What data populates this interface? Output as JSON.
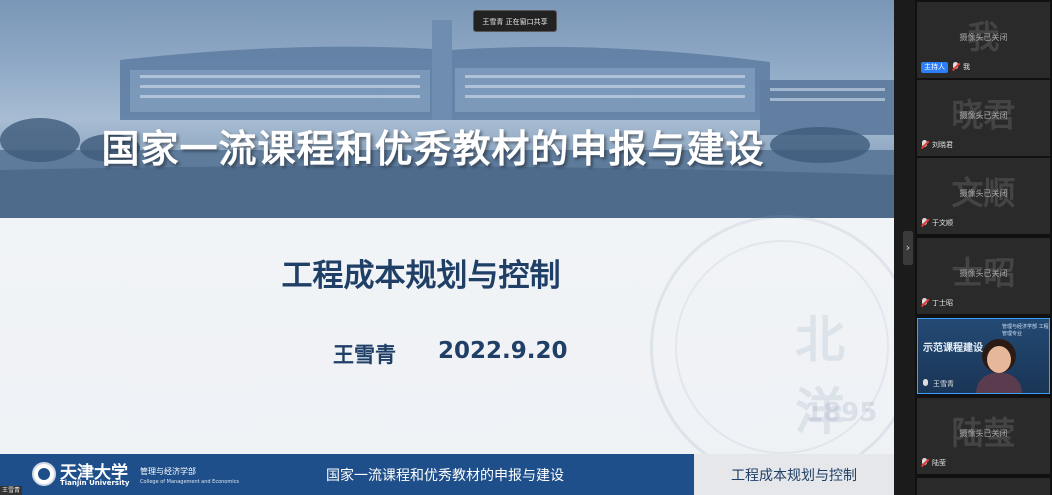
{
  "share_badge": "王雪青 正在窗口共享",
  "slide": {
    "banner_title": "国家一流课程和优秀教材的申报与建设",
    "course_title": "工程成本规划与控制",
    "author": "王雪青",
    "date": "2022.9.20",
    "seal_text": "北洋",
    "seal_year": "1895",
    "footer": {
      "university_cn": "天津大学",
      "university_en": "Tianjin University",
      "school_cn": "管理与经济学部",
      "school_en": "College of Management and Economics",
      "center_text": "国家一流课程和优秀教材的申报与建设",
      "right_text": "工程成本规划与控制"
    },
    "speaker_label": "王雪青"
  },
  "collapse_icon": "chevron-right-icon",
  "participants": [
    {
      "initial": "我",
      "camera_status": "摄像头已关闭",
      "host_badge": "主持人",
      "name": "我",
      "mic": "off"
    },
    {
      "initial": "晓君",
      "camera_status": "摄像头已关闭",
      "name": "刘晓君",
      "mic": "off"
    },
    {
      "initial": "文顺",
      "camera_status": "摄像头已关闭",
      "name": "于文顺",
      "mic": "off"
    },
    {
      "initial": "士昭",
      "camera_status": "摄像头已关闭",
      "name": "丁士昭",
      "mic": "off"
    },
    {
      "video": true,
      "slide_top_text": "管理与经济学部 工程管理专业",
      "slide_title": "示范课程建设",
      "name": "王雪青",
      "mic": "on"
    },
    {
      "initial": "陆莹",
      "camera_status": "摄像头已关闭",
      "name": "陆莹",
      "mic": "off"
    }
  ],
  "colors": {
    "slide_navy": "#1f3f66",
    "footer_blue": "#1e4f8a",
    "host_badge_blue": "#2d7ff9",
    "active_speaker_border": "#3ba0ff"
  }
}
